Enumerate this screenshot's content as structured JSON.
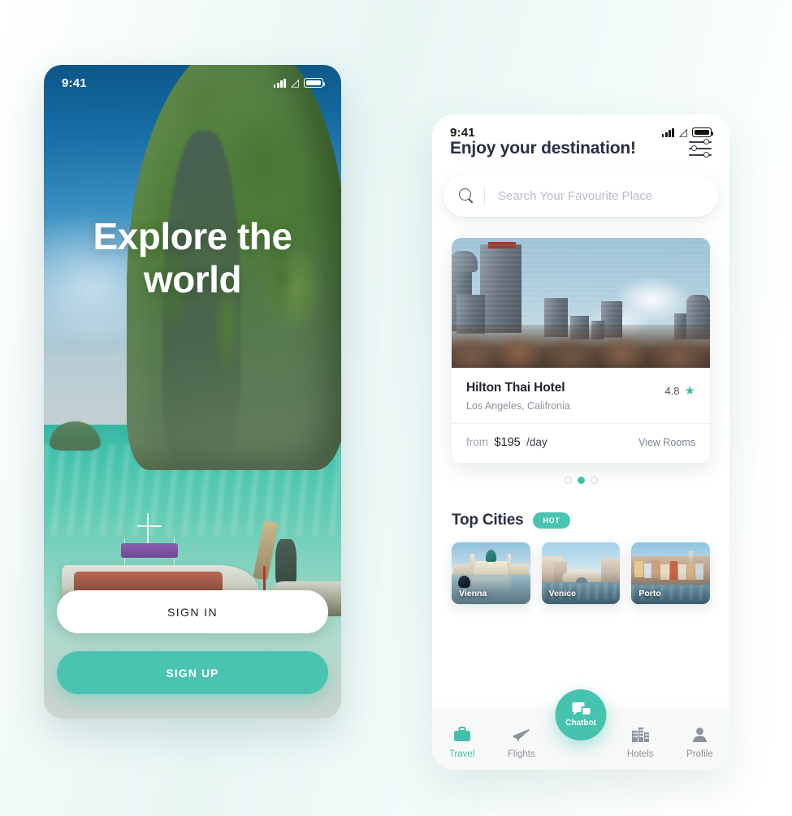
{
  "onboarding": {
    "status_bar": {
      "time": "9:41",
      "wifi_icon": "wifi-icon",
      "signal_icon": "signal-bars-icon",
      "battery_icon": "battery-icon"
    },
    "hero_title": "Explore the world",
    "sign_in_label": "SIGN IN",
    "sign_up_label": "SIGN UP"
  },
  "home": {
    "status_bar": {
      "time": "9:41",
      "wifi_icon": "wifi-icon",
      "signal_icon": "signal-bars-icon",
      "battery_icon": "battery-icon"
    },
    "header": {
      "title": "Enjoy your destination!",
      "filter_icon": "filter-sliders-icon"
    },
    "search": {
      "placeholder": "Search Your Favourite Place",
      "value": "",
      "icon": "search-icon"
    },
    "featured_hotel": {
      "name": "Hilton Thai Hotel",
      "location": "Los Angeles, Califronia",
      "rating": "4.8",
      "star_icon": "star-icon",
      "price_prefix": "from",
      "price": "$195",
      "price_unit": "/day",
      "cta": "View Rooms"
    },
    "carousel": {
      "total": 3,
      "active_index": 1
    },
    "top_cities": {
      "title": "Top Cities",
      "badge": "HOT",
      "cities": [
        {
          "name": "Vienna"
        },
        {
          "name": "Venice"
        },
        {
          "name": "Porto"
        }
      ]
    },
    "bottom_nav": {
      "items": [
        {
          "label": "Travel",
          "icon": "briefcase-icon",
          "active": true
        },
        {
          "label": "Flights",
          "icon": "airplane-icon",
          "active": false
        },
        {
          "label": "Hotels",
          "icon": "building-icon",
          "active": false
        },
        {
          "label": "Profile",
          "icon": "person-icon",
          "active": false
        }
      ],
      "fab": {
        "label": "Chatbot",
        "icon": "chat-bubbles-icon"
      }
    }
  },
  "colors": {
    "accent_teal": "#4ac4b0",
    "accent_teal_dark": "#3fc1ab",
    "heading_navy": "#2a2e44",
    "muted_gray": "#8d93a1",
    "page_bg": "#eaf7f5"
  }
}
